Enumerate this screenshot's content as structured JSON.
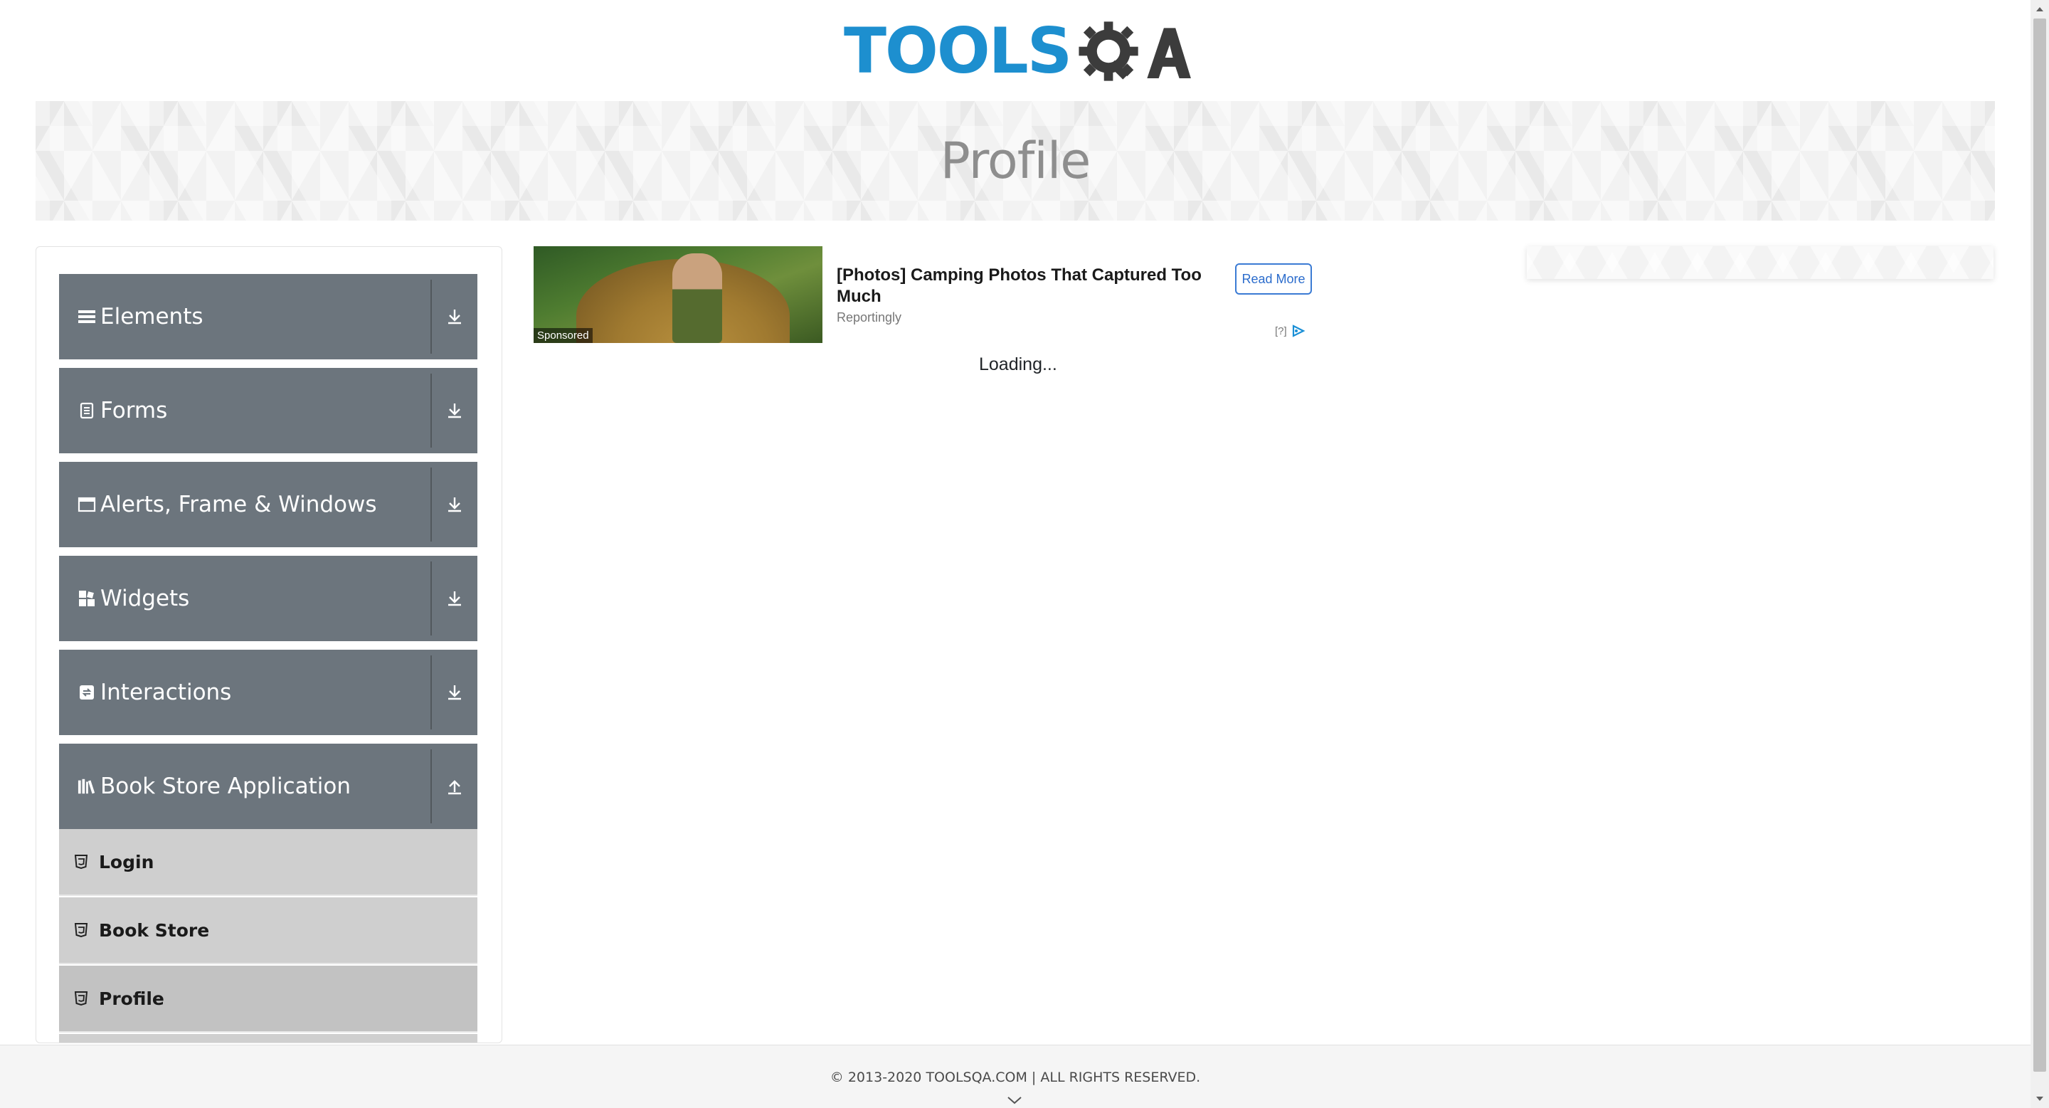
{
  "logo": {
    "text": "TOOLS",
    "accent": "#1d8fcf",
    "mark": "gear-q-a-logo"
  },
  "banner": {
    "title": "Profile"
  },
  "sidebar": {
    "groups": [
      {
        "label": "Elements",
        "icon": "hamburger-icon",
        "arrow": "download-arrow-icon"
      },
      {
        "label": "Forms",
        "icon": "document-icon",
        "arrow": "download-arrow-icon"
      },
      {
        "label": "Alerts, Frame & Windows",
        "icon": "window-icon",
        "arrow": "download-arrow-icon"
      },
      {
        "label": "Widgets",
        "icon": "widgets-icon",
        "arrow": "download-arrow-icon"
      },
      {
        "label": "Interactions",
        "icon": "interactions-icon",
        "arrow": "download-arrow-icon"
      },
      {
        "label": "Book Store Application",
        "icon": "books-icon",
        "arrow": "upload-arrow-icon"
      }
    ],
    "subitems": [
      {
        "label": "Login",
        "icon": "html5-icon"
      },
      {
        "label": "Book Store",
        "icon": "html5-icon"
      },
      {
        "label": "Profile",
        "icon": "html5-icon"
      }
    ]
  },
  "ad": {
    "sponsored": "Sponsored",
    "title": "[Photos] Camping Photos That Captured Too Much",
    "source": "Reportingly",
    "button": "Read More",
    "choice": "[?]"
  },
  "main": {
    "loading": "Loading..."
  },
  "footer": {
    "copyright": "© 2013-2020 TOOLSQA.COM | ALL RIGHTS RESERVED."
  },
  "colors": {
    "sidebar_group": "#6c757d",
    "subitem": "#cfcfcf",
    "accent_blue": "#1d8fcf"
  }
}
